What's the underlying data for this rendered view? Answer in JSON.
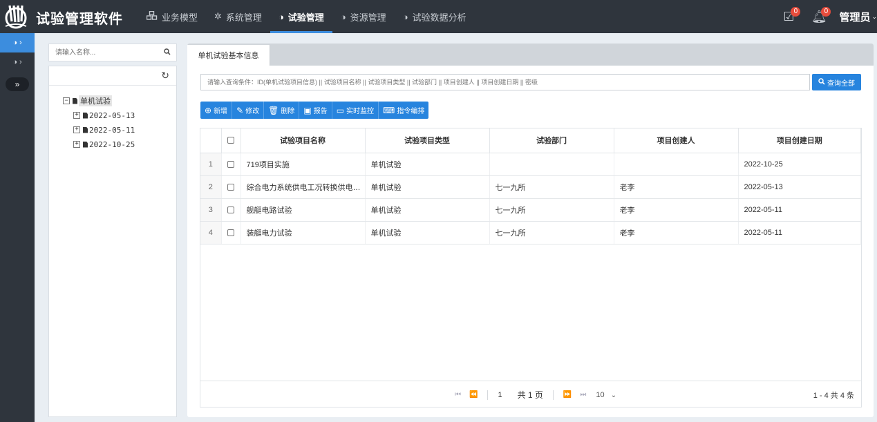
{
  "header": {
    "app_title": "试验管理软件",
    "nav": [
      {
        "label": "业务模型",
        "icon": "cubes-icon"
      },
      {
        "label": "系统管理",
        "icon": "gear-icon"
      },
      {
        "label": "试验管理",
        "icon": "half-circle-icon"
      },
      {
        "label": "资源管理",
        "icon": "half-circle-icon"
      },
      {
        "label": "试验数据分析",
        "icon": "half-circle-icon"
      }
    ],
    "active_nav": "试验管理",
    "tasks_badge": "0",
    "bell_badge": "0",
    "user": "管理员"
  },
  "sidebar": {
    "toggle_symbol": "»"
  },
  "tree_panel": {
    "search_placeholder": "请输入名称...",
    "root": "单机试验",
    "nodes": [
      "2022-05-13",
      "2022-05-11",
      "2022-10-25"
    ]
  },
  "main": {
    "tab": "单机试验基本信息",
    "query_placeholder": "请输入查询条件：ID(单机试验项目信息) || 试验项目名称 || 试验项目类型 || 试验部门 || 项目创建人 || 项目创建日期 || 密级",
    "query_button": "查询全部",
    "toolbar": {
      "add": "新增",
      "edit": "修改",
      "delete": "删除",
      "report": "报告",
      "monitor": "实时监控",
      "command": "指令编排"
    },
    "columns": [
      "试验项目名称",
      "试验项目类型",
      "试验部门",
      "项目创建人",
      "项目创建日期"
    ],
    "rows": [
      {
        "num": "1",
        "name": "719项目实施",
        "type": "单机试验",
        "dept": "",
        "creator": "",
        "date": "2022-10-25"
      },
      {
        "num": "2",
        "name": "综合电力系统供电工况转换供电试验",
        "type": "单机试验",
        "dept": "七一九所",
        "creator": "老李",
        "date": "2022-05-13"
      },
      {
        "num": "3",
        "name": "舰艇电路试验",
        "type": "单机试验",
        "dept": "七一九所",
        "creator": "老李",
        "date": "2022-05-11"
      },
      {
        "num": "4",
        "name": "装艇电力试验",
        "type": "单机试验",
        "dept": "七一九所",
        "creator": "老李",
        "date": "2022-05-11"
      }
    ],
    "pager": {
      "page": "1",
      "total_pages_text": "共 1 页",
      "page_size": "10",
      "info": "1 - 4 共 4 条"
    }
  },
  "colors": {
    "topbar": "#2f353d",
    "accent": "#2784de",
    "badge": "#e74c3c"
  }
}
